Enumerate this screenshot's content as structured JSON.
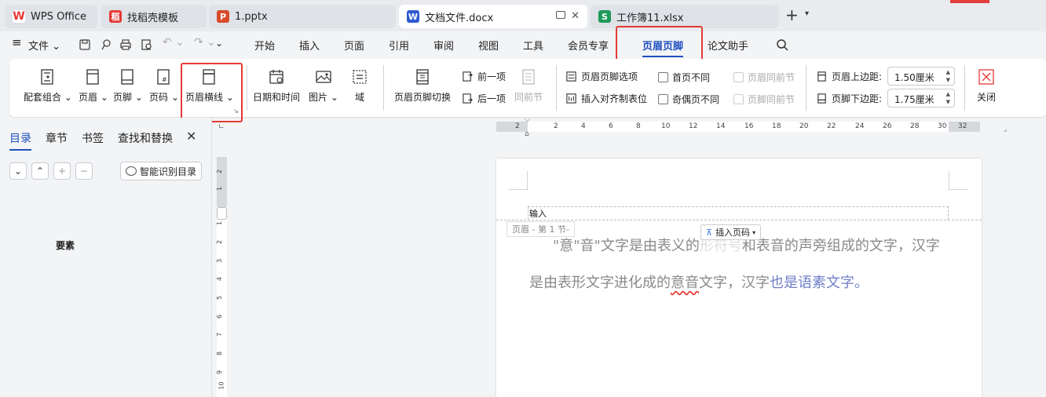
{
  "tabs": [
    {
      "label": "WPS Office",
      "icon": "wps-logo-icon",
      "color": "#e53935"
    },
    {
      "label": "找稻壳模板",
      "icon": "docer-icon",
      "color": "#e53935"
    },
    {
      "label": "1.pptx",
      "icon": "presentation-icon",
      "color": "#d84b2a"
    },
    {
      "label": "文档文件.docx",
      "icon": "writer-icon",
      "color": "#2f5bd1",
      "active": true
    },
    {
      "label": "工作簿11.xlsx",
      "icon": "spreadsheet-icon",
      "color": "#1e9a5a"
    }
  ],
  "menu": {
    "file": "文件",
    "items": [
      "开始",
      "插入",
      "页面",
      "引用",
      "审阅",
      "视图",
      "工具",
      "会员专享",
      "页眉页脚",
      "论文助手"
    ],
    "active": "页眉页脚"
  },
  "ribbon": {
    "combo": "配套组合",
    "header": "页眉",
    "footer": "页脚",
    "page_number": "页码",
    "header_line": "页眉横线",
    "date_time": "日期和时间",
    "picture": "图片",
    "field": "域",
    "switch": "页眉页脚切换",
    "prev": "前一项",
    "next": "后一项",
    "same_prev": "同前节",
    "options": "页眉页脚选项",
    "align_tab": "插入对齐制表位",
    "first_diff": "首页不同",
    "odd_even": "奇偶页不同",
    "header_same_prev": "页眉同前节",
    "footer_same_prev": "页脚同前节",
    "top_margin_label": "页眉上边距:",
    "top_margin_value": "1.50厘米",
    "bottom_margin_label": "页脚下边距:",
    "bottom_margin_value": "1.75厘米",
    "close": "关闭"
  },
  "nav": {
    "tabs": [
      "目录",
      "章节",
      "书签",
      "查找和替换"
    ],
    "active": "目录",
    "smart_toc": "智能识别目录",
    "item": "要素"
  },
  "ruler": {
    "h_ticks": [
      "2",
      "2",
      "4",
      "6",
      "8",
      "10",
      "12",
      "14",
      "16",
      "18",
      "20",
      "22",
      "24",
      "26",
      "28",
      "30",
      "32"
    ],
    "v_ticks": [
      "2",
      "1",
      "1",
      "2",
      "3",
      "4",
      "5",
      "6",
      "7",
      "8",
      "9",
      "10"
    ]
  },
  "document": {
    "header_input": "输入",
    "header_label": "页眉 - 第 1 节-",
    "insert_page_number": "插入页码",
    "text_1": "\"意\"音\"文字是由表义的",
    "text_hidden": "形符号",
    "text_2": "和表音的声旁组成的文字，汉字是由表形文字进化成的",
    "text_squig": "意音",
    "text_3": "文字，汉字",
    "text_blue": "也是语素文字",
    "text_4": "。"
  }
}
